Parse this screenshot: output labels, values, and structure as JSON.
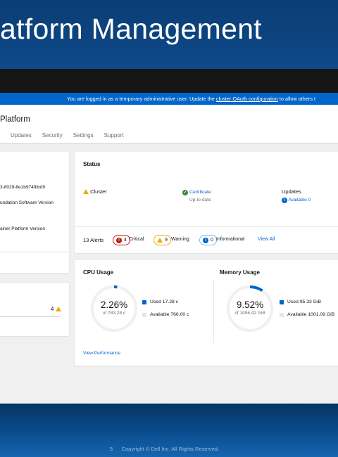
{
  "slide": {
    "title": "atform Management",
    "footer_page": "5",
    "footer_copyright": "Copyright © Dell Inc. All Rights Reserved."
  },
  "banner": {
    "text_before": "You are logged in as a temporary administrative user. Update the ",
    "link": "cluster OAuth configuration",
    "text_after": " to allow others t"
  },
  "console": {
    "title": "Platform",
    "tabs": [
      "Updates",
      "Security",
      "Settings",
      "Support"
    ]
  },
  "details": {
    "cluster_id_fragment": "3-8029-8e1b974fbbd9",
    "line1": "undation Software Version",
    "line2": "ainer Platform Version"
  },
  "inventory": {
    "warning_count": "4"
  },
  "status": {
    "title": "Status",
    "cluster_label": "Cluster",
    "certificate_label": "Certificate",
    "certificate_sub": "Up-to-date",
    "updates_label": "Updates",
    "updates_sub": "Available 0",
    "alerts_label": "13 Alerts",
    "critical_count": "4",
    "critical_label": "Critical",
    "warning_count": "9",
    "warning_label": "Warning",
    "info_count": "0",
    "info_label": "Informational",
    "view_all": "View All"
  },
  "utilization": {
    "cpu": {
      "title": "CPU Usage",
      "percent": "2.26%",
      "of_total": "of 783.28 c",
      "used": "Used 17.28 c",
      "available": "Available 766.00 c",
      "fraction": 0.0226
    },
    "memory": {
      "title": "Memory Usage",
      "percent": "9.52%",
      "of_total": "of 1096.42 GiB",
      "used": "Used 95.33 GiB",
      "available": "Available 1001.09 GiB",
      "fraction": 0.0952
    },
    "view_performance": "View Performance"
  },
  "colors": {
    "brand_blue": "#0066cc",
    "critical": "#c9190b",
    "warning": "#f0ab00",
    "success": "#3e8635",
    "info_border": "#73bcf7"
  }
}
